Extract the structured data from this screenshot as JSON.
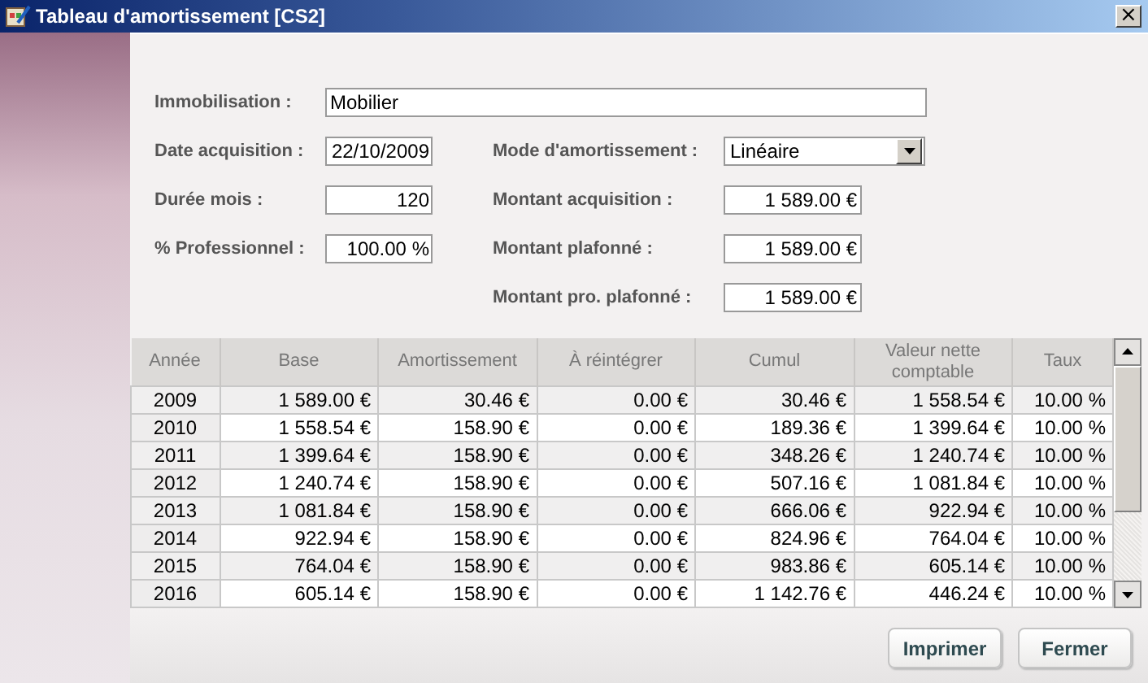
{
  "window": {
    "title": "Tableau d'amortissement [CS2]",
    "close": "×"
  },
  "form": {
    "fields": [
      {
        "label": "Immobilisation :",
        "value": "Mobilier"
      },
      {
        "label": "Date acquisition :",
        "value": "22/10/2009"
      },
      {
        "label": "Durée mois :",
        "value": "120"
      },
      {
        "label": "% Professionnel :",
        "value": "100.00 %"
      }
    ],
    "right_fields": [
      {
        "label": "Mode d'amortissement :",
        "value": "Linéaire",
        "kind": "select"
      },
      {
        "label": "Montant acquisition :",
        "value": "1 589.00 €",
        "kind": "text"
      },
      {
        "label": "Montant plafonné :",
        "value": "1 589.00 €",
        "kind": "text"
      },
      {
        "label": "Montant pro. plafonné :",
        "value": "1 589.00 €",
        "kind": "text"
      }
    ]
  },
  "table": {
    "columns": [
      "Année",
      "Base",
      "Amortissement",
      "À réintégrer",
      "Cumul",
      "Valeur nette comptable",
      "Taux"
    ],
    "rows": [
      [
        "2009",
        "1 589.00 €",
        "30.46 €",
        "0.00 €",
        "30.46 €",
        "1 558.54 €",
        "10.00 %"
      ],
      [
        "2010",
        "1 558.54 €",
        "158.90 €",
        "0.00 €",
        "189.36 €",
        "1 399.64 €",
        "10.00 %"
      ],
      [
        "2011",
        "1 399.64 €",
        "158.90 €",
        "0.00 €",
        "348.26 €",
        "1 240.74 €",
        "10.00 %"
      ],
      [
        "2012",
        "1 240.74 €",
        "158.90 €",
        "0.00 €",
        "507.16 €",
        "1 081.84 €",
        "10.00 %"
      ],
      [
        "2013",
        "1 081.84 €",
        "158.90 €",
        "0.00 €",
        "666.06 €",
        "922.94 €",
        "10.00 %"
      ],
      [
        "2014",
        "922.94 €",
        "158.90 €",
        "0.00 €",
        "824.96 €",
        "764.04 €",
        "10.00 %"
      ],
      [
        "2015",
        "764.04 €",
        "158.90 €",
        "0.00 €",
        "983.86 €",
        "605.14 €",
        "10.00 %"
      ],
      [
        "2016",
        "605.14 €",
        "158.90 €",
        "0.00 €",
        "1 142.76 €",
        "446.24 €",
        "10.00 %"
      ]
    ]
  },
  "buttons": [
    "Imprimer",
    "Fermer"
  ]
}
